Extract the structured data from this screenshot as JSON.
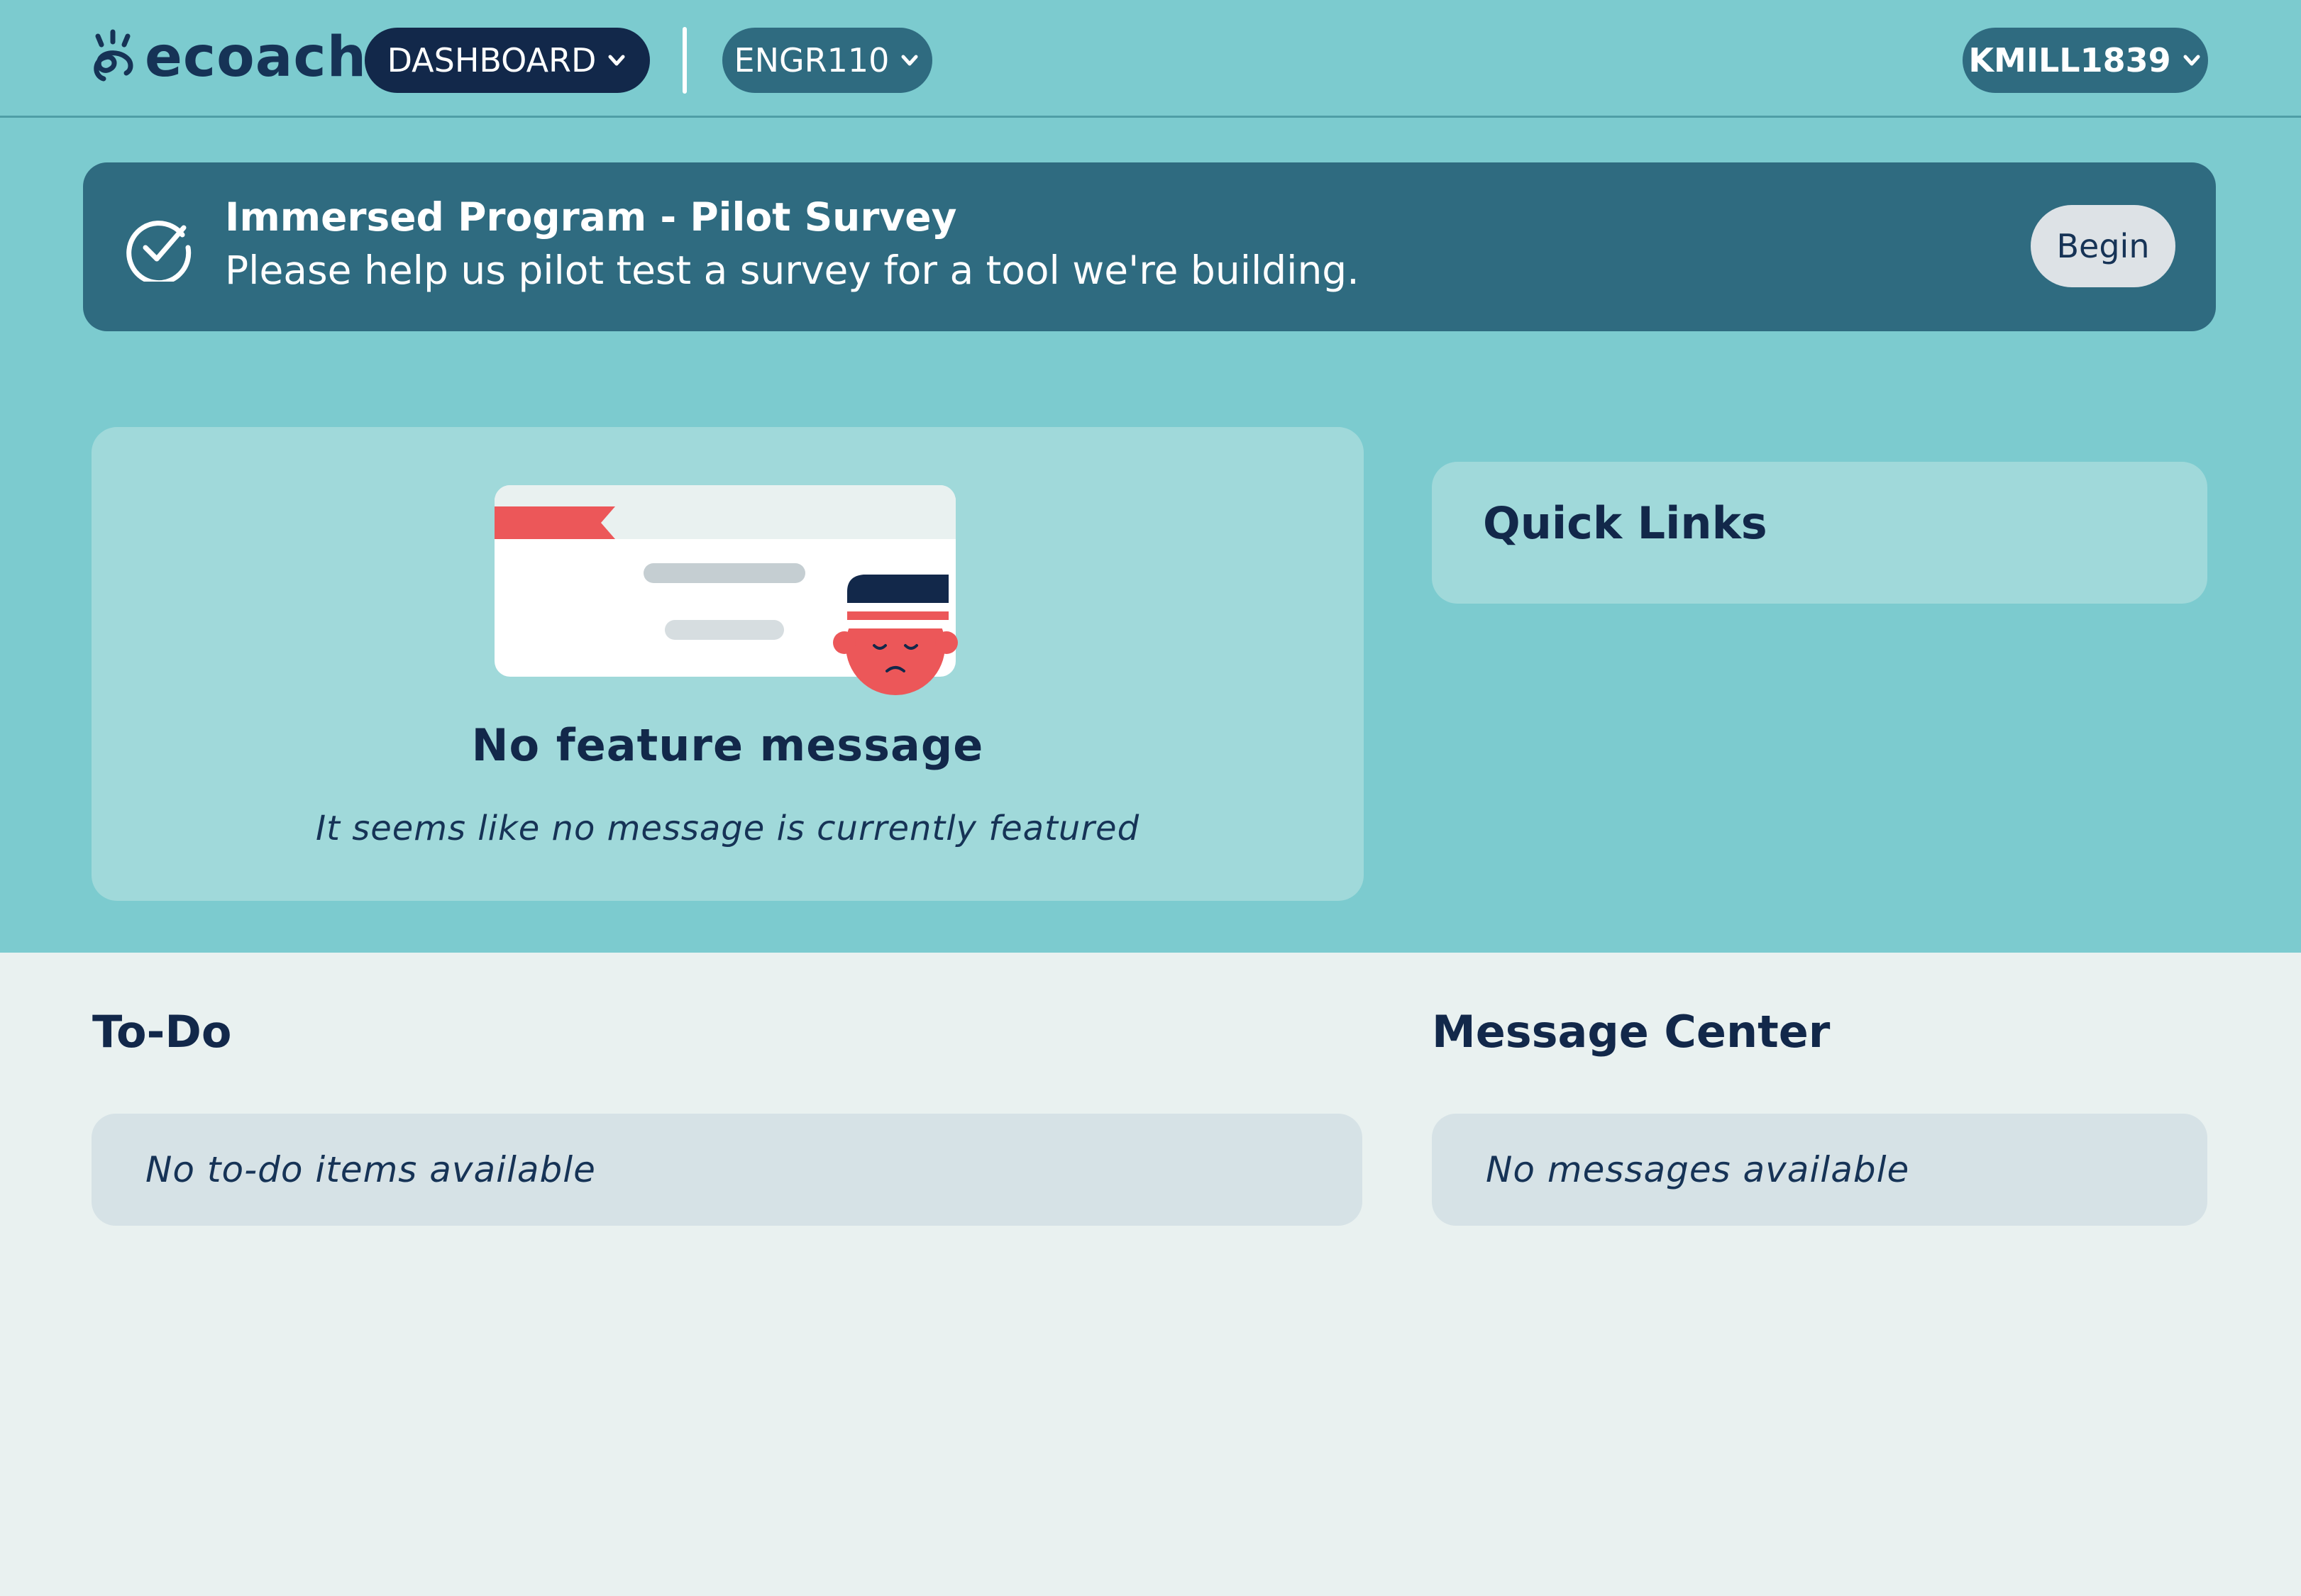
{
  "header": {
    "logo_text": "ecoach",
    "nav_dashboard": "DASHBOARD",
    "nav_course": "ENGR110",
    "user_menu": "KMILL1839"
  },
  "survey_banner": {
    "title": "Immersed Program - Pilot Survey",
    "description": "Please help us pilot test a survey for a tool we're building.",
    "button_label": "Begin"
  },
  "feature": {
    "title": "No feature message",
    "subtitle": "It seems like no message is currently featured"
  },
  "quick_links": {
    "title": "Quick Links"
  },
  "todo": {
    "title": "To-Do",
    "empty_text": "No to-do items available"
  },
  "message_center": {
    "title": "Message Center",
    "empty_text": "No messages available"
  },
  "colors": {
    "header_bg": "#7ccbcf",
    "navy": "#12284a",
    "banner": "#2f6b80",
    "card": "#a0d9da",
    "lower_bg": "#e9f1f0",
    "accent_red": "#ec5759"
  },
  "icons": [
    "ecoach-logo-icon",
    "chevron-down-icon",
    "check-circle-icon"
  ]
}
